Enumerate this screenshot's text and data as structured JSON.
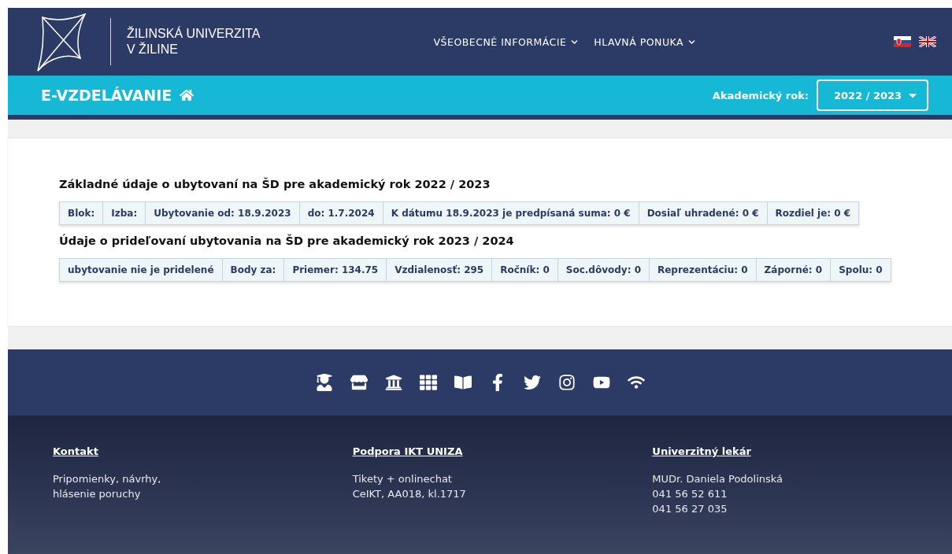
{
  "header": {
    "logo_lines": [
      "ŽILINSKÁ UNIVERZITA",
      "V ŽILINE"
    ],
    "nav": [
      {
        "label": "VŠEOBECNÉ INFORMÁCIE"
      },
      {
        "label": "HLAVNÁ PONUKA"
      }
    ],
    "languages": [
      {
        "kind": "sk"
      },
      {
        "kind": "en"
      }
    ]
  },
  "subheader": {
    "title": "E-VZDELÁVANIE",
    "year_label": "Akademický rok:",
    "year_select": "2022 / 2023"
  },
  "sections": [
    {
      "heading": "Základné údaje o ubytovaní na ŠD pre akademický rok 2022 / 2023",
      "cells": [
        "Blok:",
        "Izba:",
        "Ubytovanie od: 18.9.2023",
        "do: 1.7.2024",
        "K dátumu 18.9.2023 je predpísaná suma: 0 €",
        "Dosiaľ uhradené: 0 €",
        "Rozdiel je: 0 €"
      ]
    },
    {
      "heading": "Údaje o prideľovaní ubytovania na ŠD pre akademický rok 2023 / 2024",
      "cells": [
        "ubytovanie nie je pridelené",
        "Body za:",
        "Priemer: 134.75",
        "Vzdialenosť: 295",
        "Ročník: 0",
        "Soc.dôvody: 0",
        "Reprezentáciu: 0",
        "Záporné: 0",
        "Spolu: 0"
      ]
    }
  ],
  "footer": {
    "icons": [
      {
        "kind": "graduate"
      },
      {
        "kind": "building"
      },
      {
        "kind": "bank"
      },
      {
        "kind": "grid"
      },
      {
        "kind": "book"
      },
      {
        "kind": "facebook"
      },
      {
        "kind": "twitter"
      },
      {
        "kind": "instagram"
      },
      {
        "kind": "youtube"
      },
      {
        "kind": "wifi"
      }
    ],
    "columns": [
      {
        "title": "Kontakt",
        "lines": [
          "Pripomienky, návrhy,",
          "hlásenie poruchy"
        ]
      },
      {
        "title": "Podpora IKT UNIZA",
        "lines": [
          "Tikety + onlinechat",
          "CeIKT, AA018, kl.1717"
        ]
      },
      {
        "title": "Univerzitný lekár",
        "lines": [
          "MUDr. Daniela Podolinská",
          "041 56 52 611",
          "041 56 27 035"
        ]
      }
    ]
  }
}
